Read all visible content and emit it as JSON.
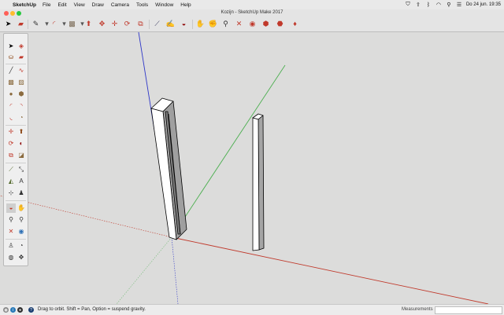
{
  "menubar": {
    "app_name": "SketchUp",
    "items": [
      "File",
      "Edit",
      "View",
      "Draw",
      "Camera",
      "Tools",
      "Window",
      "Help"
    ],
    "status_icons": [
      "shield-icon",
      "upload-icon",
      "bluetooth-icon",
      "wifi-icon",
      "search-icon",
      "control-center-icon"
    ],
    "clock": "Do 24 jun. 19:35"
  },
  "window": {
    "title": "Kozijn - SketchUp Make 2017",
    "traffic_colors": {
      "close": "#fe5f57",
      "minimize": "#febc2e",
      "zoom": "#28c840"
    }
  },
  "toolbar": {
    "tools": [
      "select-icon",
      "eraser-icon",
      "pencil-icon",
      "arc-icon",
      "rectangle-icon",
      "push-pull-icon",
      "move-icon",
      "rotate-icon",
      "scale-icon",
      "offset-icon",
      "tape-measure-icon",
      "paint-bucket-icon",
      "orbit-icon",
      "pan-icon",
      "zoom-icon",
      "zoom-extents-icon",
      "warehouse-icon",
      "extension-warehouse-icon",
      "layout-icon",
      "ruby-icon"
    ]
  },
  "tool_palette": {
    "tools": [
      "select-icon",
      "make-component-icon",
      "paint-bucket-icon",
      "eraser-icon",
      "line-icon",
      "freehand-icon",
      "rectangle-icon",
      "rotated-rectangle-icon",
      "circle-icon",
      "polygon-icon",
      "arc-icon",
      "two-point-arc-icon",
      "three-point-arc-icon",
      "pie-icon",
      "move-icon",
      "push-pull-icon",
      "rotate-icon",
      "follow-me-icon",
      "scale-icon",
      "offset-icon",
      "tape-measure-icon",
      "dimension-icon",
      "protractor-icon",
      "text-icon",
      "axes-icon",
      "3d-text-icon",
      "orbit-icon",
      "pan-icon",
      "zoom-icon",
      "zoom-window-icon",
      "zoom-extents-icon",
      "position-camera-icon",
      "walk-icon",
      "look-around-icon",
      "section-plane-icon",
      "display-section-icon"
    ]
  },
  "status": {
    "hint": "Drag to orbit. Shift = Pan, Option = suspend gravity.",
    "measurements_label": "Measurements",
    "measurements_value": ""
  },
  "colors": {
    "axis_red": "#c0392b",
    "axis_green": "#4caf50",
    "axis_blue": "#2f37c8",
    "background": "#dcdcdb"
  }
}
